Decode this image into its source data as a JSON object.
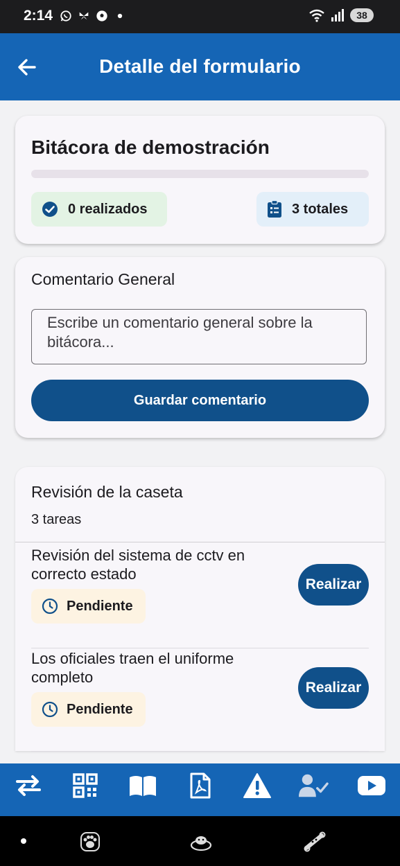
{
  "status_bar": {
    "time": "2:14",
    "battery": "38",
    "left_icons": [
      "whatsapp-icon",
      "butterfly-icon",
      "soccer-ball-icon",
      "dot-icon"
    ],
    "right_icons": [
      "wifi-icon",
      "signal-icon",
      "battery-icon"
    ]
  },
  "app_bar": {
    "title": "Detalle del formulario",
    "back_icon": "arrow-back-icon"
  },
  "summary": {
    "title": "Bitácora de demostración",
    "progress": 0,
    "done_label": "0 realizados",
    "total_label": "3 totales"
  },
  "comment": {
    "label": "Comentario General",
    "placeholder": "Escribe un comentario general sobre la bitácora...",
    "save_label": "Guardar comentario"
  },
  "section": {
    "title": "Revisión de la caseta",
    "count": "3 tareas",
    "tasks": [
      {
        "title": "Revisión del sistema de cctv en correcto estado",
        "status": "Pendiente",
        "action": "Realizar"
      },
      {
        "title": "Los oficiales traen el uniforme completo",
        "status": "Pendiente",
        "action": "Realizar"
      }
    ]
  },
  "bottom_nav": [
    "swap-icon",
    "qr-code-icon",
    "book-icon",
    "pdf-file-icon",
    "warning-icon",
    "user-check-icon",
    "youtube-icon"
  ],
  "system_nav": [
    "nav-dot-icon",
    "paw-app-icon",
    "pet-bed-icon",
    "dog-toy-icon"
  ],
  "colors": {
    "primary": "#1565b5",
    "button": "#10508a",
    "done_chip": "#e3f3e4",
    "total_chip": "#e3eff9",
    "pending_chip": "#fdf3e2"
  }
}
